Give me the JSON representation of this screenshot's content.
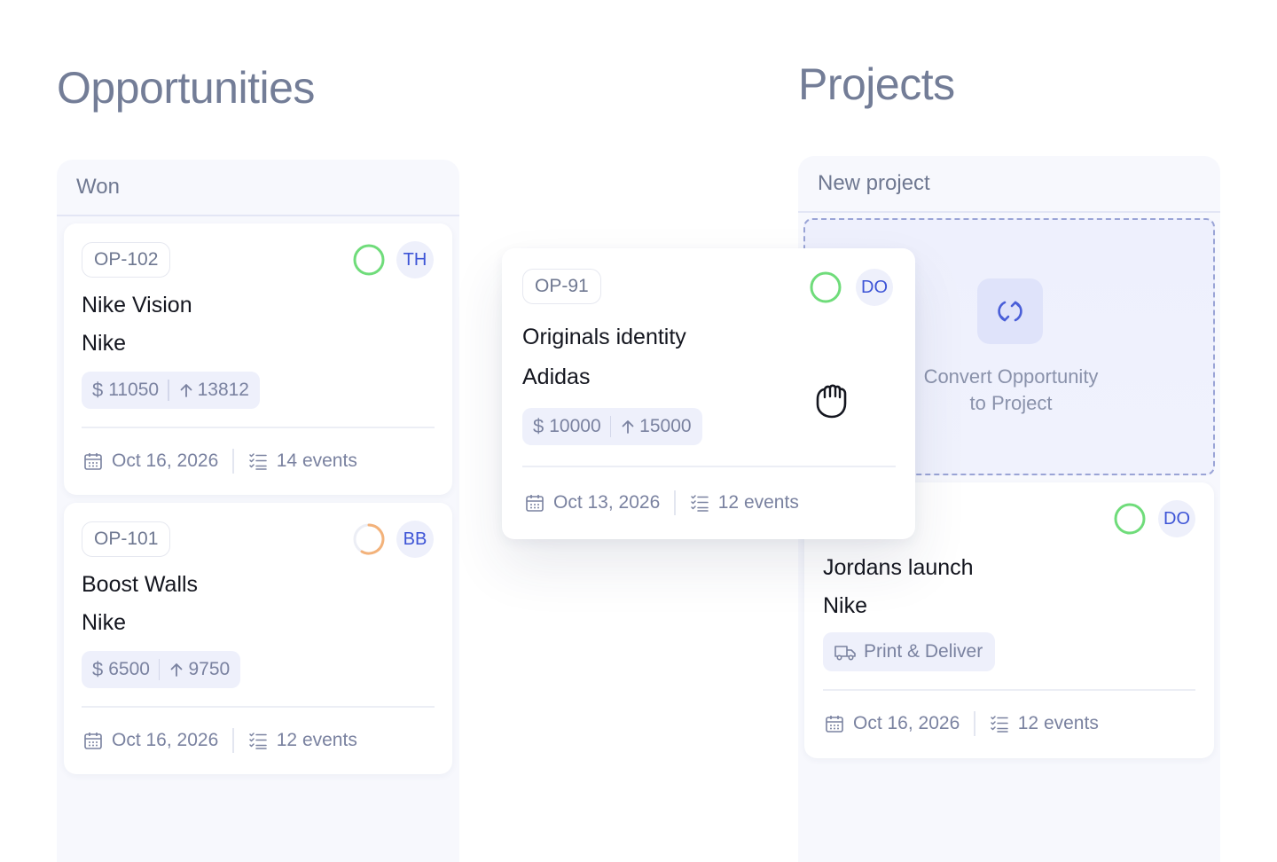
{
  "sections": {
    "opportunities_title": "Opportunities",
    "projects_title": "Projects"
  },
  "columns": {
    "won": {
      "label": "Won"
    },
    "new_project": {
      "label": "New project"
    }
  },
  "drop_zone": {
    "text_line1": "Convert Opportunity",
    "text_line2": "to Project",
    "icon": "convert-refresh-icon"
  },
  "cards": {
    "op102": {
      "code": "OP-102",
      "title": "Nike Vision",
      "client": "Nike",
      "currency": "$",
      "amount": "11050",
      "target": "13812",
      "date": "Oct 16, 2026",
      "events": "14 events",
      "avatar": "TH",
      "status": "complete"
    },
    "op101": {
      "code": "OP-101",
      "title": "Boost Walls",
      "client": "Nike",
      "currency": "$",
      "amount": "6500",
      "target": "9750",
      "date": "Oct 16, 2026",
      "events": "12 events",
      "avatar": "BB",
      "status": "in-progress"
    },
    "op91": {
      "code": "OP-91",
      "title": "Originals identity",
      "client": "Adidas",
      "currency": "$",
      "amount": "10000",
      "target": "15000",
      "date": "Oct 13, 2026",
      "events": "12 events",
      "avatar": "DO",
      "status": "complete"
    },
    "jordans": {
      "title": "Jordans launch",
      "client": "Nike",
      "tag": "Print & Deliver",
      "date": "Oct 16, 2026",
      "events": "12 events",
      "avatar": "DO",
      "status": "complete"
    }
  },
  "colors": {
    "status_green": "#6fdc7a",
    "status_orange": "#f3b27a",
    "avatar_text": "#3d54d6",
    "accent": "#4a5fd8"
  }
}
